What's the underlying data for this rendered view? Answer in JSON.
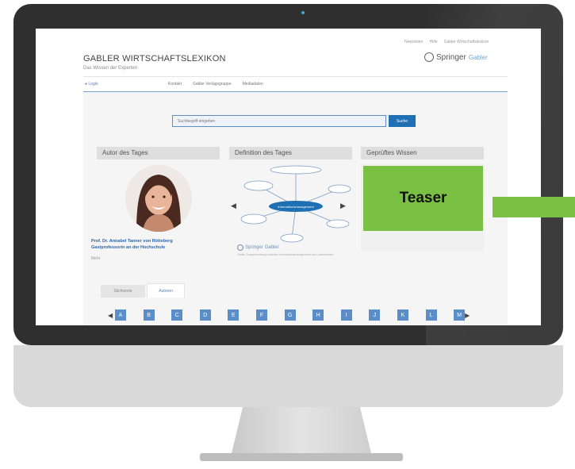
{
  "site": {
    "title": "GABLER WIRTSCHAFTSLEXIKON",
    "subtitle": "Das Wissen der Experten",
    "top_links": [
      "Newsletter",
      "Hilfe",
      "Gabler Wirtschaftslexikon"
    ],
    "logo": {
      "brand": "Springer",
      "sub": "Gabler"
    }
  },
  "nav": {
    "login": "Login",
    "items": [
      "Kontakt",
      "Gabler Verlagsgruppe",
      "Mediadaten"
    ]
  },
  "search": {
    "placeholder": "Suchbegriff eingeben",
    "button": "Suche"
  },
  "sections": {
    "author": "Autor des Tages",
    "definition": "Definition des Tages",
    "knowledge": "Geprüftes Wissen"
  },
  "author": {
    "name": "Prof. Dr. Annabel Tanner von Rötteberg",
    "role": "Gastprofessorin an der Hochschule",
    "meta": "Mehr"
  },
  "definition": {
    "center_node": "Informationsmanagement",
    "springer": "Springer",
    "springer_sub": "Gabler",
    "caption": "Grafik: Zusammenhang zwischen Informationsmanagement und Unternehmen"
  },
  "tabs": [
    "Stichworte",
    "Autoren"
  ],
  "alphabet": [
    "A",
    "B",
    "C",
    "D",
    "E",
    "F",
    "G",
    "H",
    "I",
    "J",
    "K",
    "L",
    "M"
  ],
  "teaser": {
    "label": "Teaser"
  },
  "colors": {
    "accent": "#7ac143",
    "link": "#2a67b0",
    "button": "#1f6fb5"
  }
}
